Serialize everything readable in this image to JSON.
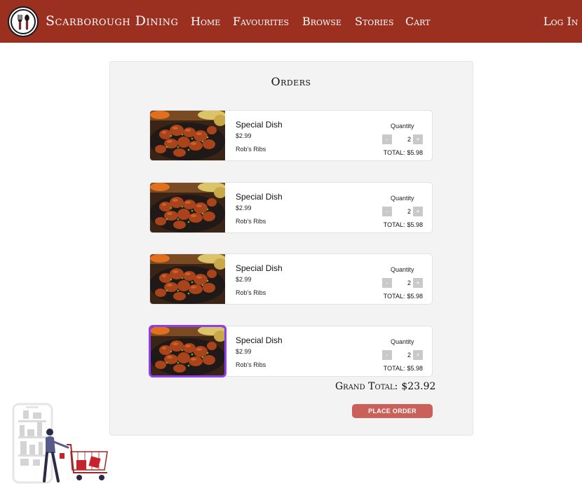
{
  "header": {
    "brand": "Scarborough Dining",
    "nav": [
      "Home",
      "Favourites",
      "Browse",
      "Stories",
      "Cart"
    ],
    "login": "Log In",
    "color": "#9c3020"
  },
  "main": {
    "title": "Orders",
    "quantity_label": "Quantity",
    "total_label": "TOTAL:",
    "selected_color": "#8b3ff0",
    "items": [
      {
        "name": "Special Dish",
        "price": "$2.99",
        "restaurant": "Rob's Ribs",
        "quantity": "2",
        "total": "$5.98",
        "selected": false
      },
      {
        "name": "Special Dish",
        "price": "$2.99",
        "restaurant": "Rob's Ribs",
        "quantity": "2",
        "total": "$5.98",
        "selected": false
      },
      {
        "name": "Special Dish",
        "price": "$2.99",
        "restaurant": "Rob's Ribs",
        "quantity": "2",
        "total": "$5.98",
        "selected": false
      },
      {
        "name": "Special Dish",
        "price": "$2.99",
        "restaurant": "Rob's Ribs",
        "quantity": "2",
        "total": "$5.98",
        "selected": true
      }
    ],
    "stepper": {
      "minus": "-",
      "plus": "+"
    },
    "grand_total_label": "Grand Total:",
    "grand_total_value": "$23.92",
    "place_order": "PLACE ORDER",
    "button_color": "#c9605a"
  },
  "icons": {
    "logo": "fork-spoon-icon",
    "illustration": "shopping-cart-illustration"
  }
}
